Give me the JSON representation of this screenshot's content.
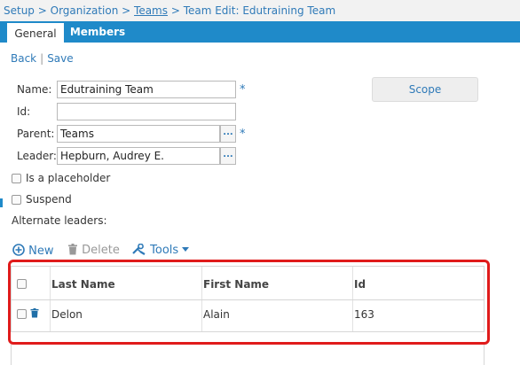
{
  "breadcrumb": {
    "setup": "Setup",
    "sep1": " > ",
    "organization": "Organization",
    "sep2": " > ",
    "teams": "Teams",
    "sep3": " > ",
    "current": "Team Edit: Edutraining Team"
  },
  "tabs": [
    {
      "label": "General",
      "active": true
    },
    {
      "label": "Members",
      "active": false
    }
  ],
  "actions": {
    "back": "Back",
    "separator": "|",
    "save": "Save"
  },
  "form": {
    "name_label": "Name:",
    "name_value": "Edutraining Team",
    "id_label": "Id:",
    "id_value": "",
    "parent_label": "Parent:",
    "parent_value": "Teams",
    "leader_label": "Leader:",
    "leader_value": "Hepburn, Audrey E.",
    "required_mark": "*",
    "browse_label": "...",
    "scope_label": "Scope",
    "placeholder_label": "Is a placeholder",
    "placeholder_checked": false,
    "suspend_label": "Suspend",
    "suspend_checked": false,
    "alternate_leaders_label": "Alternate leaders:"
  },
  "grid_toolbar": {
    "new_label": "New",
    "delete_label": "Delete",
    "tools_label": "Tools"
  },
  "grid": {
    "columns": [
      "Last Name",
      "First Name",
      "Id"
    ],
    "rows": [
      {
        "last_name": "Delon",
        "first_name": "Alain",
        "id": "163",
        "checked": false
      }
    ]
  },
  "colors": {
    "accent": "#1f8ac9",
    "link": "#2f7ab8",
    "highlight": "#e01b1b"
  }
}
